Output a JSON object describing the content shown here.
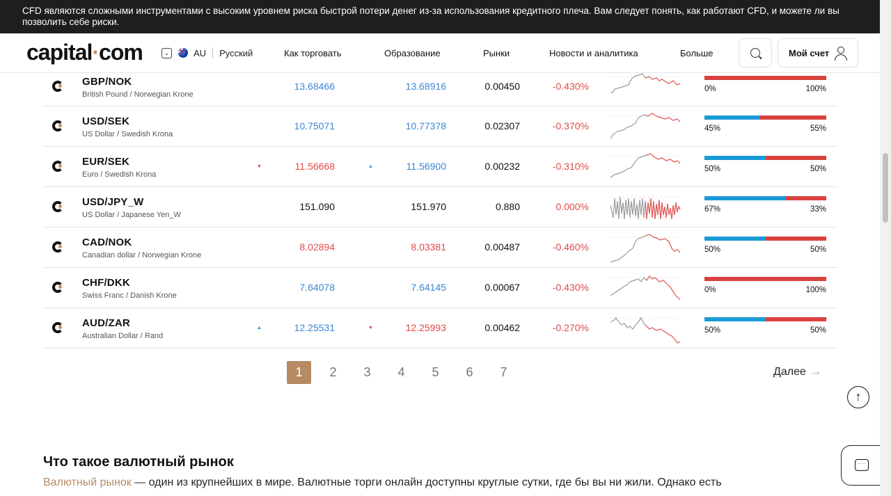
{
  "risk_banner": "CFD являются сложными инструментами с высоким уровнем риска быстрой потери денег из-за использования кредитного плеча. Вам следует понять, как работают CFD, и можете ли вы позволить себе риски.",
  "header": {
    "logo_main": "capital",
    "logo_dot": "·",
    "logo_tail": "com",
    "region": "AU",
    "language": "Русский",
    "nav": [
      "Как торговать",
      "Образование",
      "Рынки",
      "Новости и аналитика",
      "Больше"
    ],
    "account_label": "Мой счет"
  },
  "rows": [
    {
      "symbol": "GBP/NOK",
      "desc": "British Pound / Norwegian Krone",
      "sell": "13.68466",
      "sell_color": "blue",
      "buy": "13.68916",
      "buy_color": "blue",
      "spread": "0.00450",
      "change": "-0.430%",
      "buy_pct": 0,
      "sent_left": "0%",
      "sent_right": "100%",
      "arrow_sell": "",
      "arrow_buy": ""
    },
    {
      "symbol": "USD/SEK",
      "desc": "US Dollar / Swedish Krona",
      "sell": "10.75071",
      "sell_color": "blue",
      "buy": "10.77378",
      "buy_color": "blue",
      "spread": "0.02307",
      "change": "-0.370%",
      "buy_pct": 45,
      "sent_left": "45%",
      "sent_right": "55%",
      "arrow_sell": "",
      "arrow_buy": ""
    },
    {
      "symbol": "EUR/SEK",
      "desc": "Euro / Swedish Krona",
      "sell": "11.56668",
      "sell_color": "red",
      "buy": "11.56900",
      "buy_color": "blue",
      "spread": "0.00232",
      "change": "-0.310%",
      "buy_pct": 50,
      "sent_left": "50%",
      "sent_right": "50%",
      "arrow_sell": "down",
      "arrow_buy": "up"
    },
    {
      "symbol": "USD/JPY_W",
      "desc": "US Dollar / Japanese Yen_W",
      "sell": "151.090",
      "sell_color": "black",
      "buy": "151.970",
      "buy_color": "black",
      "spread": "0.880",
      "change": "0.000%",
      "buy_pct": 67,
      "sent_left": "67%",
      "sent_right": "33%",
      "arrow_sell": "",
      "arrow_buy": ""
    },
    {
      "symbol": "CAD/NOK",
      "desc": "Canadian dollar / Norwegian Krone",
      "sell": "8.02894",
      "sell_color": "red",
      "buy": "8.03381",
      "buy_color": "red",
      "spread": "0.00487",
      "change": "-0.460%",
      "buy_pct": 50,
      "sent_left": "50%",
      "sent_right": "50%",
      "arrow_sell": "",
      "arrow_buy": ""
    },
    {
      "symbol": "CHF/DKK",
      "desc": "Swiss Franc / Danish Krone",
      "sell": "7.64078",
      "sell_color": "blue",
      "buy": "7.64145",
      "buy_color": "blue",
      "spread": "0.00067",
      "change": "-0.430%",
      "buy_pct": 0,
      "sent_left": "0%",
      "sent_right": "100%",
      "arrow_sell": "",
      "arrow_buy": ""
    },
    {
      "symbol": "AUD/ZAR",
      "desc": "Australian Dollar / Rand",
      "sell": "12.25531",
      "sell_color": "blue",
      "buy": "12.25993",
      "buy_color": "red",
      "spread": "0.00462",
      "change": "-0.270%",
      "buy_pct": 50,
      "sent_left": "50%",
      "sent_right": "50%",
      "arrow_sell": "up",
      "arrow_buy": "down"
    }
  ],
  "pagination": {
    "pages": [
      "1",
      "2",
      "3",
      "4",
      "5",
      "6",
      "7"
    ],
    "active": "1",
    "next_label": "Далее"
  },
  "section": {
    "title": "Что такое валютный рынок",
    "link": "Валютный рынок",
    "text": " — один из крупнейших в мире. Валютные торги онлайн доступны круглые сутки, где бы вы ни жили. Однако есть"
  },
  "colors": {
    "accent": "#b78a63",
    "buy_bar": "#1a9ad6",
    "sell_bar": "#d9413f",
    "up": "#3b86d0",
    "down": "#e04b4b"
  }
}
